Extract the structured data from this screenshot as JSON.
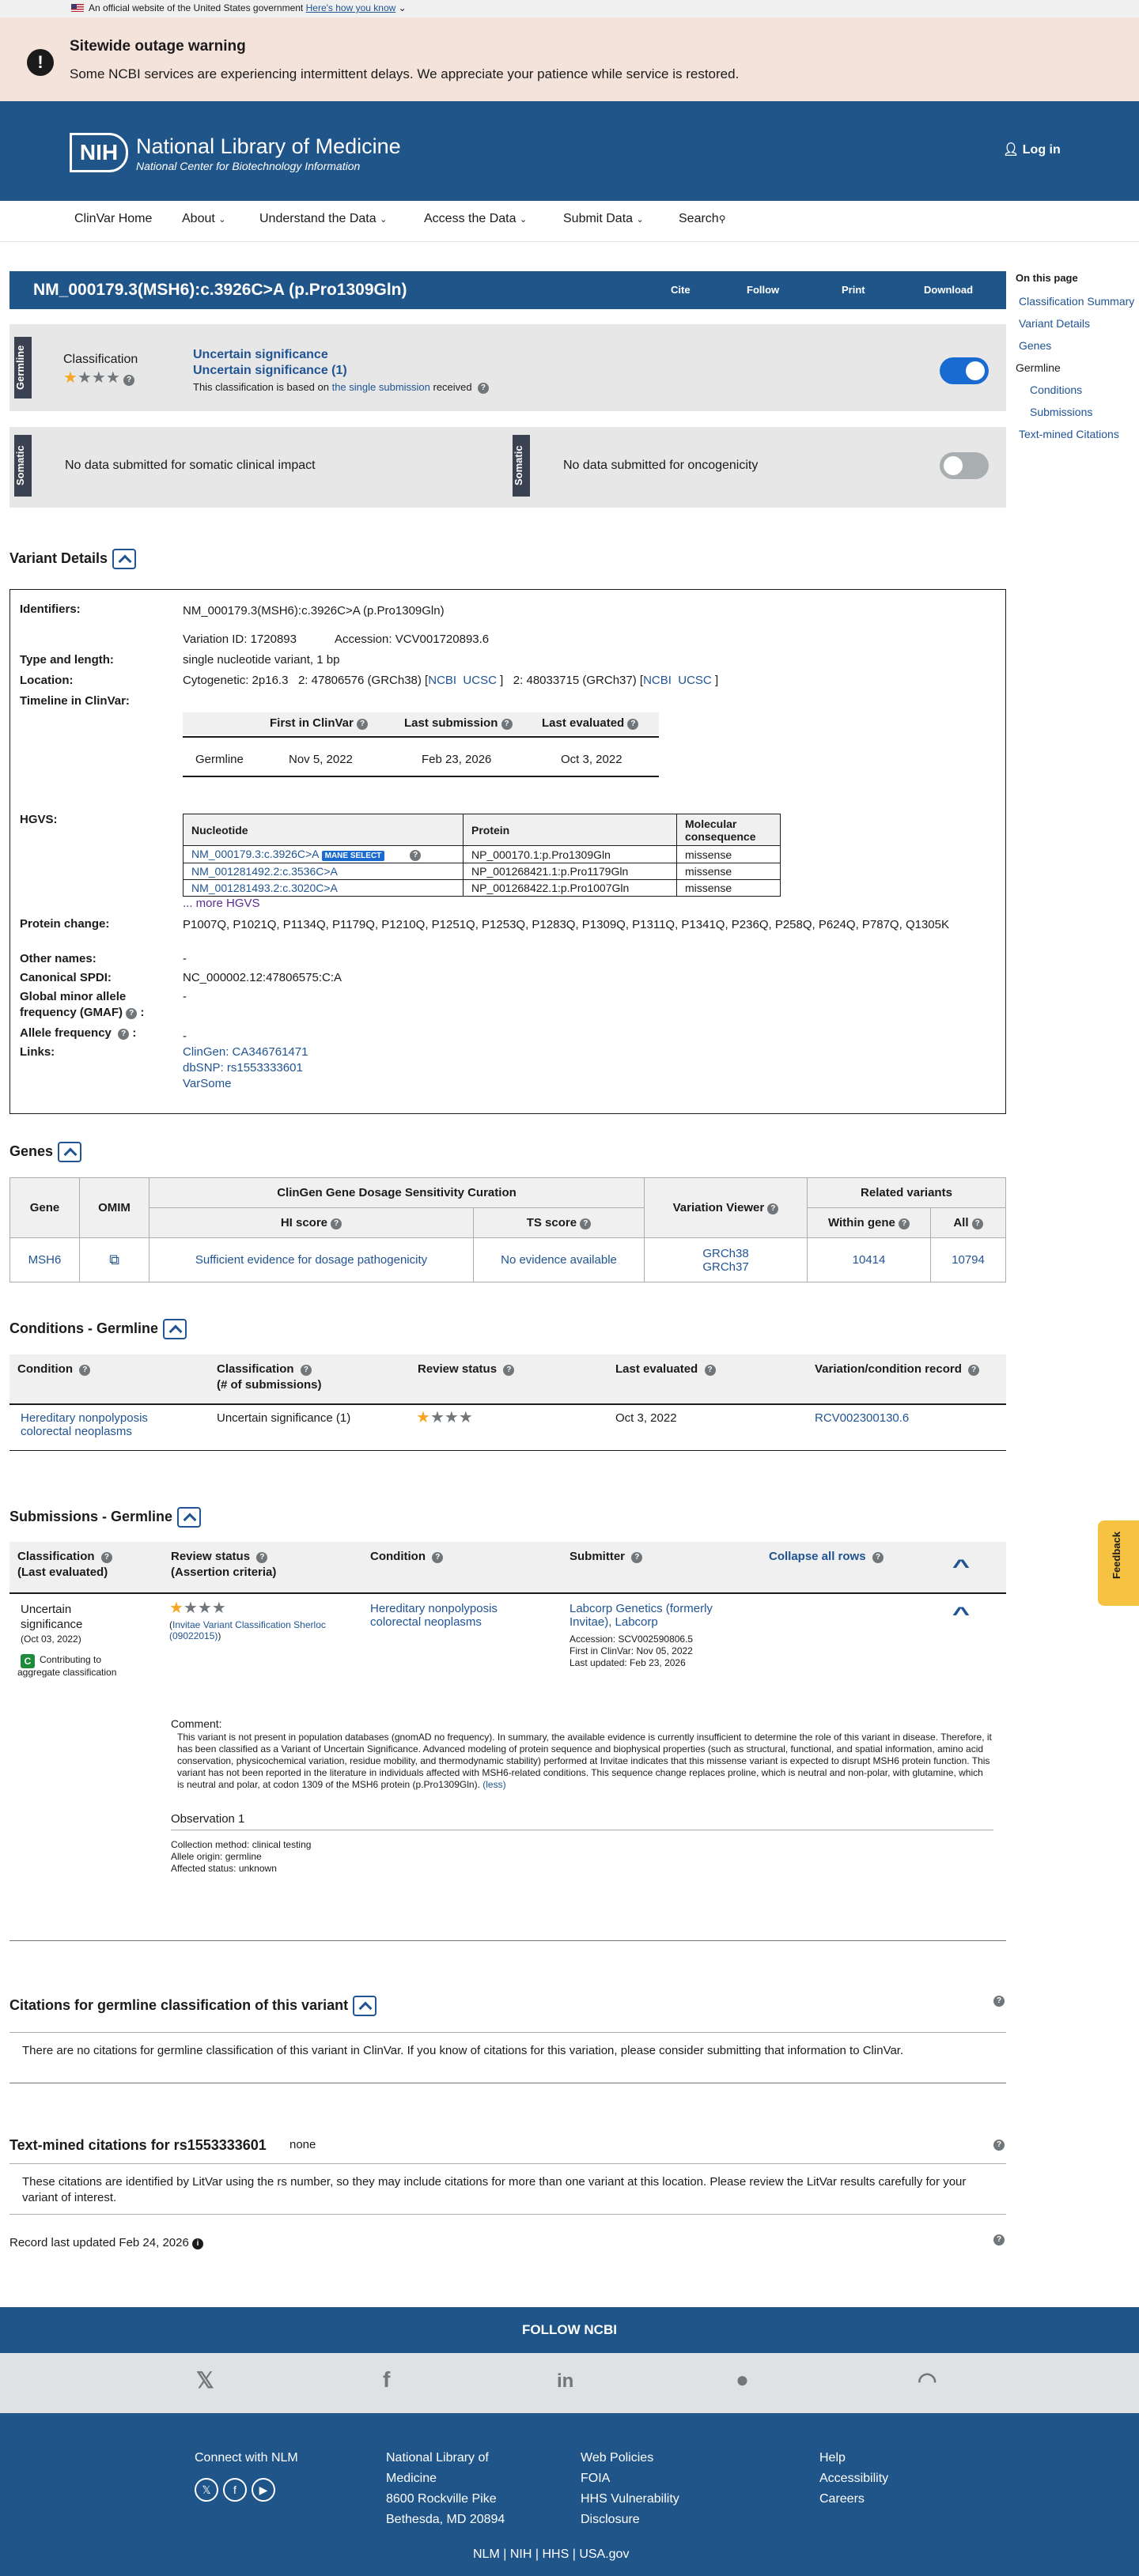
{
  "gov_banner": {
    "text": "An official website of the United States government",
    "link": "Here's how you know"
  },
  "alert": {
    "title": "Sitewide outage warning",
    "message": "Some NCBI services are experiencing intermittent delays. We appreciate your patience while service is restored."
  },
  "header": {
    "logo": "NIH",
    "title": "National Library of Medicine",
    "subtitle": "National Center for Biotechnology Information",
    "login": "Log in"
  },
  "nav": {
    "items": [
      "ClinVar Home",
      "About",
      "Understand the Data",
      "Access the Data",
      "Submit Data",
      "Search"
    ]
  },
  "variant": {
    "title": "NM_000179.3(MSH6):c.3926C>A (p.Pro1309Gln)",
    "actions": [
      "Cite",
      "Follow",
      "Print",
      "Download"
    ]
  },
  "germline_panel": {
    "tab": "Germline",
    "label": "Classification",
    "line1": "Uncertain significance",
    "line2": "Uncertain significance (1)",
    "basis_pre": "This classification is based on ",
    "basis_link": "the single submission",
    "basis_post": " received",
    "stars": 1
  },
  "somatic_panel": {
    "tab": "Somatic",
    "left": "No data submitted for somatic clinical impact",
    "right": "No data submitted for oncogenicity"
  },
  "on_this_page": {
    "title": "On this page",
    "items": [
      "Classification Summary",
      "Variant Details",
      "Genes",
      "Germline",
      "Conditions",
      "Submissions",
      "Text-mined Citations"
    ]
  },
  "variant_details": {
    "heading": "Variant Details",
    "identifiers_label": "Identifiers:",
    "identifiers": "NM_000179.3(MSH6):c.3926C>A (p.Pro1309Gln)",
    "variation_id": "Variation ID: 1720893",
    "accession": "Accession: VCV001720893.6",
    "type_label": "Type and length:",
    "type": "single nucleotide variant, 1 bp",
    "location_label": "Location:",
    "cytogenetic": "Cytogenetic: 2p16.3",
    "loc38": "2: 47806576 (GRCh38) [",
    "loc37": "2: 48033715 (GRCh37) [",
    "ncbi": "NCBI",
    "ucsc": "UCSC",
    "close": "]",
    "timeline_label": "Timeline in ClinVar:",
    "timeline_headers": [
      "First in ClinVar",
      "Last submission",
      "Last evaluated"
    ],
    "timeline_row": [
      "Germline",
      "Nov 5, 2022",
      "Feb 23, 2026",
      "Oct 3, 2022"
    ],
    "hgvs_label": "HGVS:",
    "hgvs_headers": [
      "Nucleotide",
      "Protein",
      "Molecular consequence"
    ],
    "hgvs_rows": [
      [
        "NM_000179.3:c.3926C>A",
        "NP_000170.1:p.Pro1309Gln",
        "missense"
      ],
      [
        "NM_001281492.2:c.3536C>A",
        "NP_001268421.1:p.Pro1179Gln",
        "missense"
      ],
      [
        "NM_001281493.2:c.3020C>A",
        "NP_001268422.1:p.Pro1007Gln",
        "missense"
      ]
    ],
    "mane": "MANE SELECT",
    "more_hgvs": "... more HGVS",
    "protein_change_label": "Protein change:",
    "protein_change": "P1007Q, P1021Q, P1134Q, P1179Q, P1210Q, P1251Q, P1253Q, P1283Q, P1309Q, P1311Q, P1341Q, P236Q, P258Q, P624Q, P787Q, Q1305K",
    "other_names_label": "Other names:",
    "other_names": "-",
    "spdi_label": "Canonical SPDI:",
    "spdi": "NC_000002.12:47806575:C:A",
    "gmaf_label1": "Global minor allele",
    "gmaf_label2": "frequency (GMAF)",
    "gmaf": "-",
    "af_label": "Allele frequency",
    "af": "-",
    "links_label": "Links:",
    "links": [
      "ClinGen: CA346761471",
      "dbSNP: rs1553333601",
      "VarSome"
    ]
  },
  "genes": {
    "heading": "Genes",
    "h_gene": "Gene",
    "h_omim": "OMIM",
    "h_clingen": "ClinGen Gene Dosage Sensitivity Curation",
    "h_hi": "HI score",
    "h_ts": "TS score",
    "h_viewer": "Variation Viewer",
    "h_related": "Related variants",
    "h_within": "Within gene",
    "h_all": "All",
    "row": {
      "gene": "MSH6",
      "hi": "Sufficient evidence for dosage pathogenicity",
      "ts": "No evidence available",
      "grch38": "GRCh38",
      "grch37": "GRCh37",
      "within": "10414",
      "all": "10794"
    }
  },
  "conditions": {
    "heading": "Conditions - Germline",
    "headers": [
      "Condition",
      "Classification",
      "(# of submissions)",
      "Review status",
      "Last evaluated",
      "Variation/condition record"
    ],
    "row": {
      "condition": "Hereditary nonpolyposis colorectal neoplasms",
      "classification": "Uncertain significance (1)",
      "last_evaluated": "Oct 3, 2022",
      "record": "RCV002300130.6"
    }
  },
  "submissions": {
    "heading": "Submissions - Germline",
    "h_class": "Classification",
    "h_class2": "(Last evaluated)",
    "h_review": "Review status",
    "h_review2": "(Assertion criteria)",
    "h_condition": "Condition",
    "h_submitter": "Submitter",
    "collapse": "Collapse all rows",
    "row": {
      "class1": "Uncertain",
      "class2": "significance",
      "date": "(Oct 03, 2022)",
      "badge": "C",
      "contrib1": "Contributing to",
      "contrib2": "aggregate classification",
      "criteria_pre": "(",
      "criteria": "Invitae Variant Classification Sherloc (09022015)",
      "criteria_post": ")",
      "condition": "Hereditary nonpolyposis colorectal neoplasms",
      "submitter": "Labcorp Genetics (formerly Invitae), Labcorp",
      "accession": "Accession: SCV002590806.5",
      "first": "First in ClinVar: Nov 05, 2022",
      "updated": "Last updated: Feb 23, 2026"
    },
    "comment_label": "Comment:",
    "comment": "This variant is not present in population databases (gnomAD no frequency). In summary, the available evidence is currently insufficient to determine the role of this variant in disease. Therefore, it has been classified as a Variant of Uncertain Significance. Advanced modeling of protein sequence and biophysical properties (such as structural, functional, and spatial information, amino acid conservation, physicochemical variation, residue mobility, and thermodynamic stability) performed at Invitae indicates that this missense variant is expected to disrupt MSH6 protein function. This variant has not been reported in the literature in individuals affected with MSH6-related conditions. This sequence change replaces proline, which is neutral and non-polar, with glutamine, which is neutral and polar, at codon 1309 of the MSH6 protein (p.Pro1309Gln).",
    "less": "(less)",
    "observation": "Observation 1",
    "method": "Collection method: clinical testing",
    "origin": "Allele origin: germline",
    "affected": "Affected status: unknown"
  },
  "citations": {
    "heading": "Citations for germline classification of this variant",
    "text": "There are no citations for germline classification of this variant in ClinVar. If you know of citations for this variation, please consider submitting that information to ClinVar."
  },
  "textmined": {
    "heading": "Text-mined citations for rs1553333601",
    "none": "none",
    "text": "These citations are identified by LitVar using the rs number, so they may include citations for more than one variant at this location. Please review the LitVar results carefully for your variant of interest."
  },
  "record_updated": "Record last updated Feb 24, 2026",
  "feedback": "Feedback",
  "footer": {
    "follow": "FOLLOW NCBI",
    "connect": "Connect with NLM",
    "nlm1": "National Library of",
    "nlm2": "Medicine",
    "addr1": "8600 Rockville Pike",
    "addr2": "Bethesda, MD 20894",
    "policies": [
      "Web Policies",
      "FOIA",
      "HHS Vulnerability",
      "Disclosure"
    ],
    "help": [
      "Help",
      "Accessibility",
      "Careers"
    ],
    "bottom": [
      "NLM",
      "NIH",
      "HHS",
      "USA.gov"
    ],
    "sep": "|"
  },
  "colors": {
    "primary": "#20558a",
    "link": "#205493",
    "alert_bg": "#f4e3db",
    "panel": "#e7e7e7",
    "star": "#f5a623",
    "toggle_on": "#1a6bd1",
    "badge": "#1e8a3b",
    "mane": "#1a6bd1"
  }
}
